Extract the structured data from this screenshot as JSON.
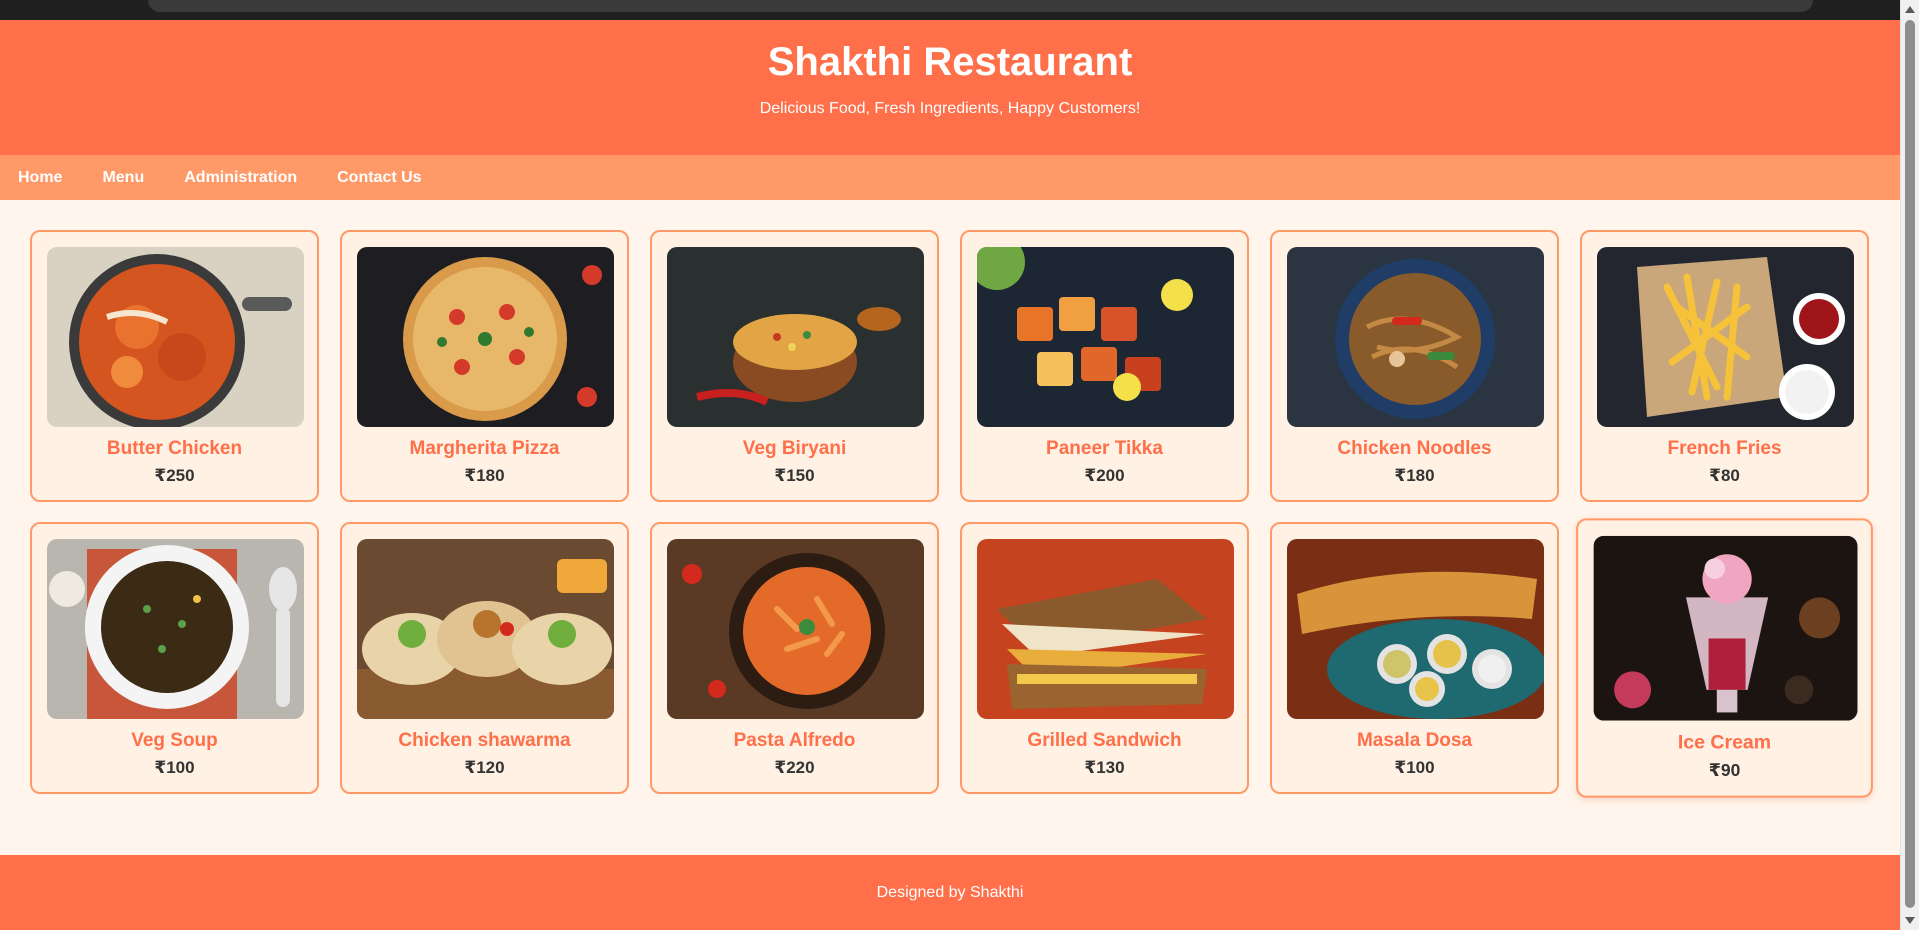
{
  "header": {
    "title": "Shakthi Restaurant",
    "subtitle": "Delicious Food, Fresh Ingredients, Happy Customers!"
  },
  "nav": {
    "items": [
      {
        "label": "Home"
      },
      {
        "label": "Menu"
      },
      {
        "label": "Administration"
      },
      {
        "label": "Contact Us"
      }
    ]
  },
  "menu": {
    "items": [
      {
        "name": "Butter Chicken",
        "price": "₹250",
        "image": "butter-chicken-image"
      },
      {
        "name": "Margherita Pizza",
        "price": "₹180",
        "image": "margherita-pizza-image"
      },
      {
        "name": "Veg Biryani",
        "price": "₹150",
        "image": "veg-biryani-image"
      },
      {
        "name": "Paneer Tikka",
        "price": "₹200",
        "image": "paneer-tikka-image"
      },
      {
        "name": "Chicken Noodles",
        "price": "₹180",
        "image": "chicken-noodles-image"
      },
      {
        "name": "French Fries",
        "price": "₹80",
        "image": "french-fries-image"
      },
      {
        "name": "Veg Soup",
        "price": "₹100",
        "image": "veg-soup-image"
      },
      {
        "name": "Chicken shawarma",
        "price": "₹120",
        "image": "chicken-shawarma-image"
      },
      {
        "name": "Pasta Alfredo",
        "price": "₹220",
        "image": "pasta-alfredo-image"
      },
      {
        "name": "Grilled Sandwich",
        "price": "₹130",
        "image": "grilled-sandwich-image"
      },
      {
        "name": "Masala Dosa",
        "price": "₹100",
        "image": "masala-dosa-image"
      },
      {
        "name": "Ice Cream",
        "price": "₹90",
        "image": "ice-cream-image"
      }
    ]
  },
  "footer": {
    "text": "Designed by Shakthi"
  },
  "colors": {
    "header_bg": "#ff6f4a",
    "nav_bg": "#ff9a68",
    "page_bg": "#fff5ec",
    "card_bg": "#fff1e3",
    "accent_text": "#ff6f4a"
  }
}
